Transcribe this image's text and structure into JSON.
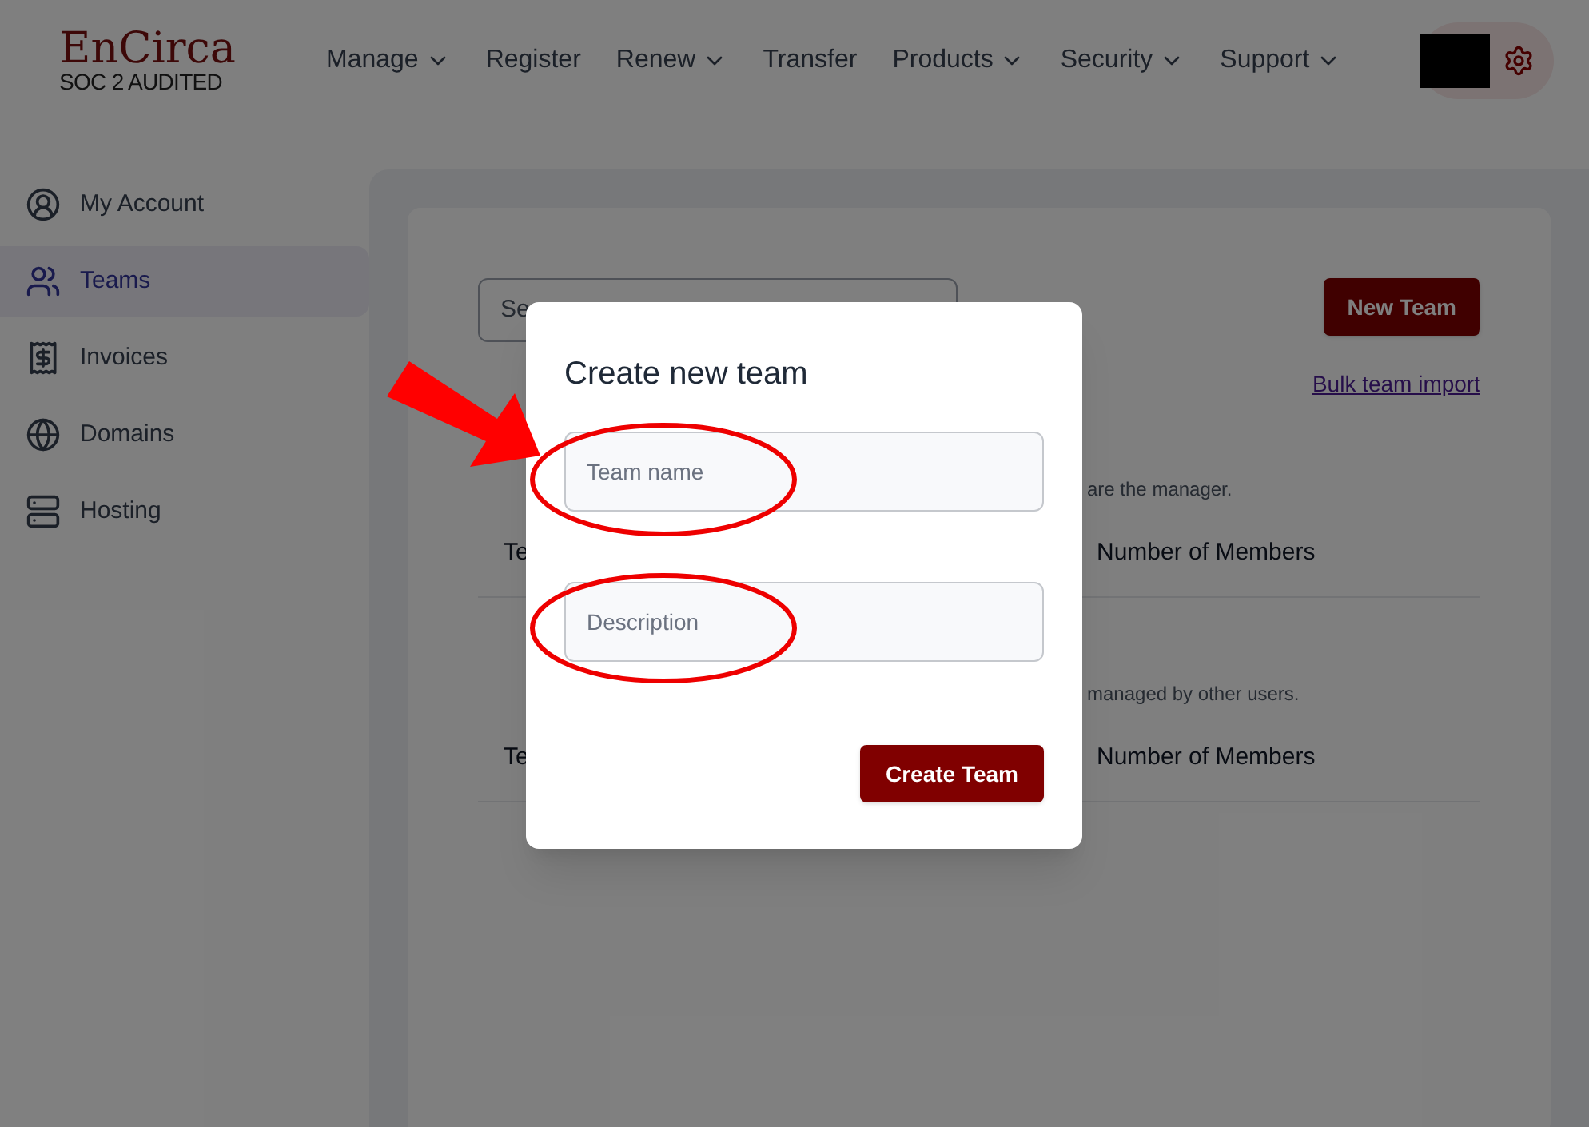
{
  "logo": {
    "name": "EnCirca",
    "tagline": "SOC 2 AUDITED"
  },
  "nav": [
    {
      "label": "Manage",
      "dropdown": true
    },
    {
      "label": "Register",
      "dropdown": false
    },
    {
      "label": "Renew",
      "dropdown": true
    },
    {
      "label": "Transfer",
      "dropdown": false
    },
    {
      "label": "Products",
      "dropdown": true
    },
    {
      "label": "Security",
      "dropdown": true
    },
    {
      "label": "Support",
      "dropdown": true
    }
  ],
  "sidebar": {
    "items": [
      {
        "label": "My Account",
        "kind": "account",
        "selected": false
      },
      {
        "label": "Teams",
        "kind": "teams",
        "selected": true
      },
      {
        "label": "Invoices",
        "kind": "invoices",
        "selected": false
      },
      {
        "label": "Domains",
        "kind": "domains",
        "selected": false
      },
      {
        "label": "Hosting",
        "kind": "hosting",
        "selected": false
      }
    ]
  },
  "teams_page": {
    "search": {
      "value": "Se"
    },
    "new_team_button": "New Team",
    "bulk_import_link": "Bulk team import",
    "sections": [
      {
        "description": "are the manager.",
        "columns": [
          "Te",
          "Number of Members"
        ]
      },
      {
        "description": "managed by other users.",
        "columns": [
          "Te",
          "Number of Members"
        ]
      }
    ]
  },
  "modal": {
    "title": "Create new team",
    "fields": [
      {
        "placeholder": "Team name"
      },
      {
        "placeholder": "Description"
      }
    ],
    "submit_button": "Create Team"
  }
}
